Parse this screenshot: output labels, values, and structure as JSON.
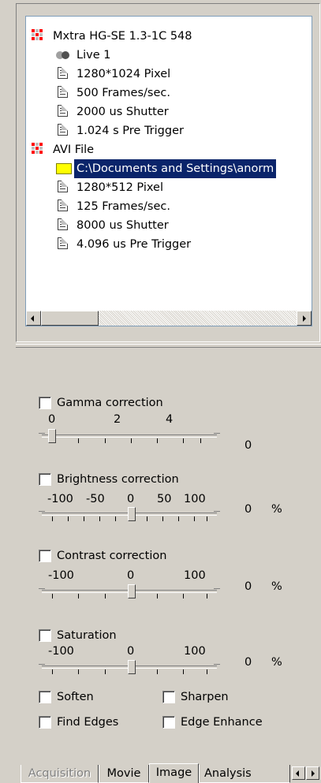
{
  "tree": {
    "items": [
      {
        "label": "Mxtra HG-SE 1.3-1C 548",
        "icon": "camera-node-icon",
        "indent": 0
      },
      {
        "label": "Live 1",
        "icon": "live-lens-icon",
        "indent": 1
      },
      {
        "label": "1280*1024 Pixel",
        "icon": "document-icon",
        "indent": 1
      },
      {
        "label": "500 Frames/sec.",
        "icon": "document-icon",
        "indent": 1
      },
      {
        "label": "2000 us Shutter",
        "icon": "document-icon",
        "indent": 1
      },
      {
        "label": "1.024 s Pre Trigger",
        "icon": "document-icon",
        "indent": 1
      },
      {
        "label": "AVI File",
        "icon": "camera-node-icon",
        "indent": 0
      },
      {
        "label": "C:\\Documents and Settings\\anorm",
        "icon": "folder-icon",
        "indent": 1,
        "selected": true
      },
      {
        "label": "1280*512 Pixel",
        "icon": "document-icon",
        "indent": 1
      },
      {
        "label": "125 Frames/sec.",
        "icon": "document-icon",
        "indent": 1
      },
      {
        "label": "8000 us Shutter",
        "icon": "document-icon",
        "indent": 1
      },
      {
        "label": "4.096 us Pre Trigger",
        "icon": "document-icon",
        "indent": 1
      }
    ]
  },
  "gamma": {
    "label": "Gamma correction",
    "ticks": [
      "0",
      "2",
      "4"
    ],
    "value": "0",
    "unit": ""
  },
  "brightness": {
    "label": "Brightness correction",
    "ticks": [
      "-100",
      "-50",
      "0",
      "50",
      "100"
    ],
    "value": "0",
    "unit": "%"
  },
  "contrast": {
    "label": "Contrast correction",
    "ticks": [
      "-100",
      "0",
      "100"
    ],
    "value": "0",
    "unit": "%"
  },
  "saturation": {
    "label": "Saturation",
    "ticks": [
      "-100",
      "0",
      "100"
    ],
    "value": "0",
    "unit": "%"
  },
  "filters": {
    "soften": "Soften",
    "sharpen": "Sharpen",
    "find_edges": "Find Edges",
    "edge_enhance": "Edge Enhance"
  },
  "tabs": {
    "acquisition": "Acquisition",
    "movie": "Movie",
    "image": "Image",
    "analysis": "Analysis",
    "active": "Image"
  },
  "colors": {
    "selection": "#0a246a",
    "panel": "#d4d0c8",
    "camera_red": "#ff0000"
  }
}
